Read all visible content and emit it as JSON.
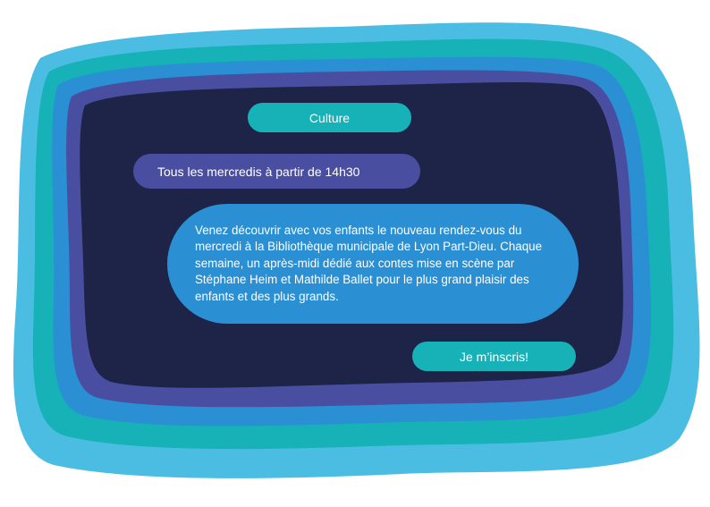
{
  "colors": {
    "outer_layer": "#4cbde2",
    "teal_layer": "#17b1b8",
    "blue_layer": "#2a8fd3",
    "violet_layer": "#4a4ea0",
    "panel_background": "#1d2448",
    "culture_tag": "#16b2b8",
    "schedule_pill": "#4a4ea0",
    "description_bubble": "#2a8fd3",
    "cta_button": "#16b2b8",
    "text": "#ffffff"
  },
  "tag": {
    "label": "Culture"
  },
  "schedule": {
    "text": "Tous les mercredis à partir de 14h30"
  },
  "description": {
    "text": "Venez découvrir avec vos enfants le nouveau rendez-vous du mercredi à la Bibliothèque municipale de Lyon Part-Dieu. Chaque semaine, un après-midi dédié aux contes mise en scène par Stéphane Heim et Mathilde Ballet pour le plus grand plaisir des enfants et des plus grands."
  },
  "cta": {
    "label": "Je m’inscris!"
  }
}
